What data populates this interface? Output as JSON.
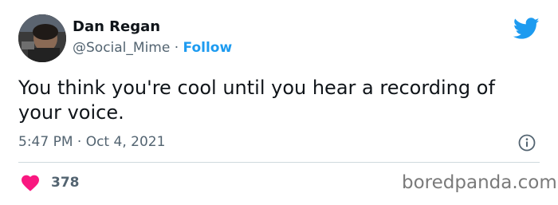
{
  "user": {
    "display_name": "Dan Regan",
    "handle": "@Social_Mime",
    "separator": "·",
    "follow_label": "Follow",
    "avatar_icon": "avatar-photo"
  },
  "tweet": {
    "text": "You think you're cool until you hear a recording of your voice.",
    "timestamp": "5:47 PM · Oct 4, 2021"
  },
  "engagement": {
    "likes": "378",
    "like_icon": "heart-icon",
    "info_icon": "info-icon"
  },
  "brand": {
    "logo_icon": "twitter-bird-icon",
    "accent_color": "#1d9bf0",
    "like_color": "#f91880"
  },
  "watermark": "boredpanda.com"
}
